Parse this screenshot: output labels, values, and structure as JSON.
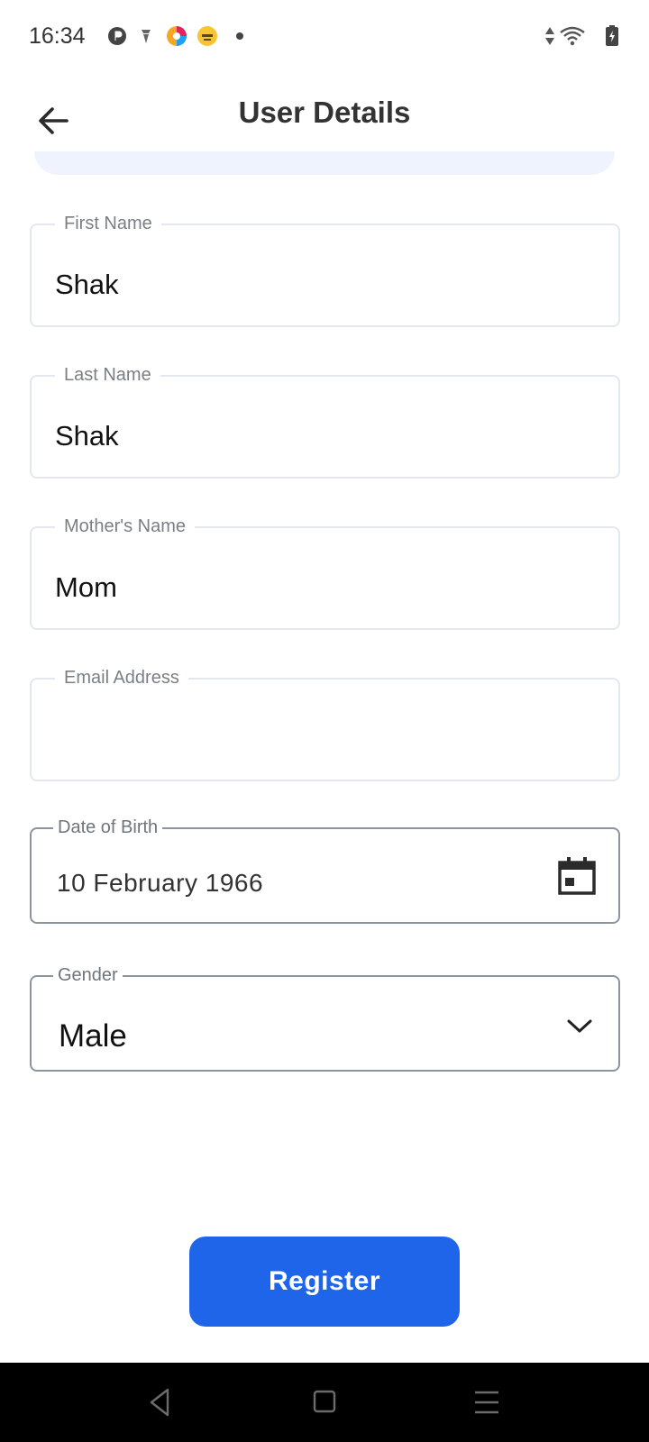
{
  "status_bar": {
    "time": "16:34",
    "left_icons": [
      "p-circle-icon",
      "vpn-shield-icon",
      "colorful-app-icon",
      "emoji-app-icon",
      "notification-dot-icon"
    ],
    "right_icons": [
      "data-arrows-icon",
      "wifi-icon",
      "battery-charging-icon"
    ]
  },
  "header": {
    "title": "User Details",
    "back_icon": "arrow-left-icon"
  },
  "form": {
    "first_name": {
      "label": "First Name",
      "value": "Shak"
    },
    "last_name": {
      "label": "Last Name",
      "value": "Shak"
    },
    "mother_name": {
      "label": "Mother's Name",
      "value": "Mom"
    },
    "email": {
      "label": "Email Address",
      "value": ""
    },
    "dob": {
      "label": "Date of Birth",
      "value": "10 February 1966",
      "icon": "calendar-icon"
    },
    "gender": {
      "label": "Gender",
      "value": "Male",
      "icon": "chevron-down-icon"
    }
  },
  "actions": {
    "register_label": "Register",
    "accent_color": "#1f65ea"
  },
  "nav_bar": {
    "icons": [
      "back-triangle-icon",
      "home-square-icon",
      "menu-lines-icon"
    ]
  }
}
